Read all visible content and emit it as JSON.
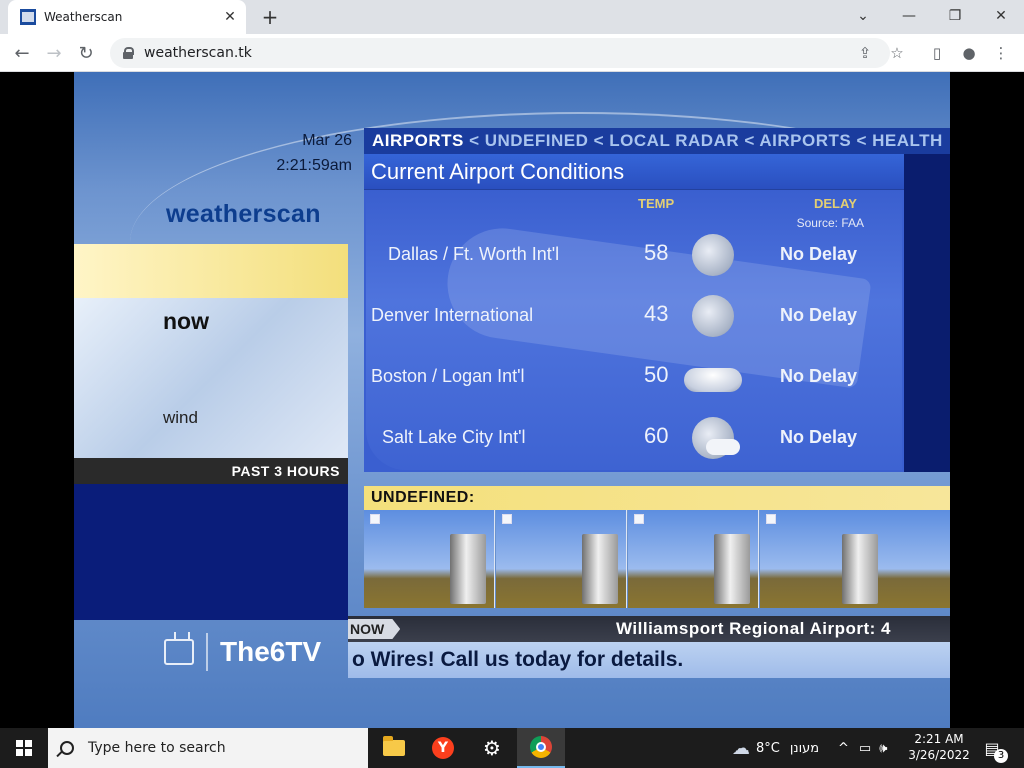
{
  "browser": {
    "tab_title": "Weatherscan",
    "url": "weatherscan.tk",
    "new_tab": "+",
    "tab_close": "✕",
    "back": "←",
    "forward": "→",
    "reload": "↻",
    "window": {
      "tablist": "⌄",
      "minimize": "—",
      "restore": "❐",
      "close": "✕"
    },
    "toolbar_icons": {
      "share": "⇪",
      "star": "☆",
      "sidebar": "▯",
      "profile": "●",
      "menu": "⋮"
    }
  },
  "weatherscan": {
    "date": "Mar 26",
    "time": "2:21:59am",
    "logo": "weatherscan",
    "now_label": "now",
    "wind_label": "wind",
    "past_label": "PAST 3 HOURS",
    "brand": "The6TV",
    "breadcrumbs": {
      "current": "AIRPORTS",
      "items": [
        "< UNDEFINED",
        "< LOCAL RADAR",
        "< AIRPORTS",
        "< HEALTH"
      ]
    },
    "airport_panel": {
      "title": "Current Airport Conditions",
      "temp_header": "TEMP",
      "delay_header": "DELAY",
      "source": "Source: FAA",
      "rows": [
        {
          "name": "Dallas / Ft. Worth Int'l",
          "temp": "58",
          "icon": "moon-icon",
          "delay": "No Delay"
        },
        {
          "name": "Denver International",
          "temp": "43",
          "icon": "moon-icon",
          "delay": "No Delay"
        },
        {
          "name": "Boston / Logan Int'l",
          "temp": "50",
          "icon": "cloud-icon",
          "delay": "No Delay"
        },
        {
          "name": "Salt Lake City Int'l",
          "temp": "60",
          "icon": "partly-cloudy-moon-icon",
          "delay": "No Delay"
        }
      ]
    },
    "undefined_label": "UNDEFINED:",
    "ticker": {
      "now_tag": "NOW",
      "line1": "Williamsport Regional Airport: 4",
      "line2": "o Wires! Call us today for details."
    }
  },
  "taskbar": {
    "search_placeholder": "Type here to search",
    "apps": [
      "file-explorer-icon",
      "yandex-icon",
      "settings-icon",
      "chrome-icon"
    ],
    "weather": "8°C",
    "weather_desc": "מעונן",
    "tray_icons": {
      "chevron": "^",
      "network": "▭",
      "volume": "🕪"
    },
    "time": "2:21 AM",
    "date": "3/26/2022",
    "notifications": "3",
    "notifications_icon": "▤"
  },
  "colors": {
    "accent_blue": "#1a3c9e",
    "panel_blue": "#3a5fd0",
    "yellow": "#f4e07b",
    "navy": "#0a1d7a"
  }
}
